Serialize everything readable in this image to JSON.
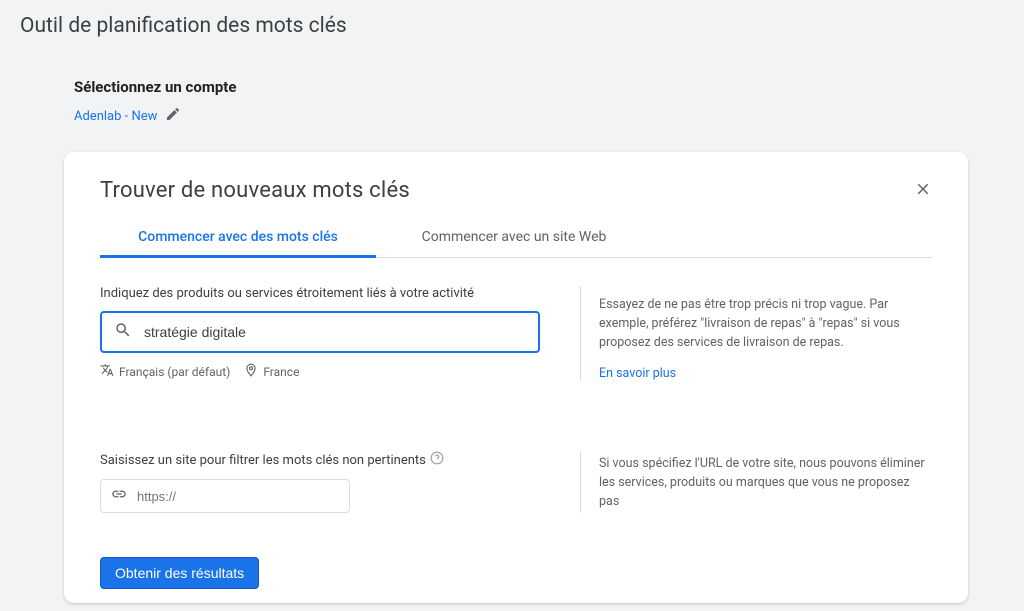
{
  "header": {
    "title": "Outil de planification des mots clés"
  },
  "account": {
    "heading": "Sélectionnez un compte",
    "link": "Adenlab - New"
  },
  "card": {
    "title": "Trouver de nouveaux mots clés",
    "tabs": {
      "keywords": "Commencer avec des mots clés",
      "website": "Commencer avec un site Web"
    },
    "keywords_section": {
      "label": "Indiquez des produits ou services étroitement liés à votre activité",
      "input_value": "stratégie digitale",
      "language": "Français (par défaut)",
      "location": "France",
      "help_text": "Essayez de ne pas être trop précis ni trop vague. Par exemple, préférez \"livraison de repas\" à \"repas\" si vous proposez des services de livraison de repas.",
      "learn_more": "En savoir plus"
    },
    "url_section": {
      "label": "Saisissez un site pour filtrer les mots clés non pertinents",
      "placeholder": "https://",
      "help_text": "Si vous spécifiez l'URL de votre site, nous pouvons éliminer les services, produits ou marques que vous ne proposez pas"
    },
    "submit_button": "Obtenir des résultats"
  }
}
